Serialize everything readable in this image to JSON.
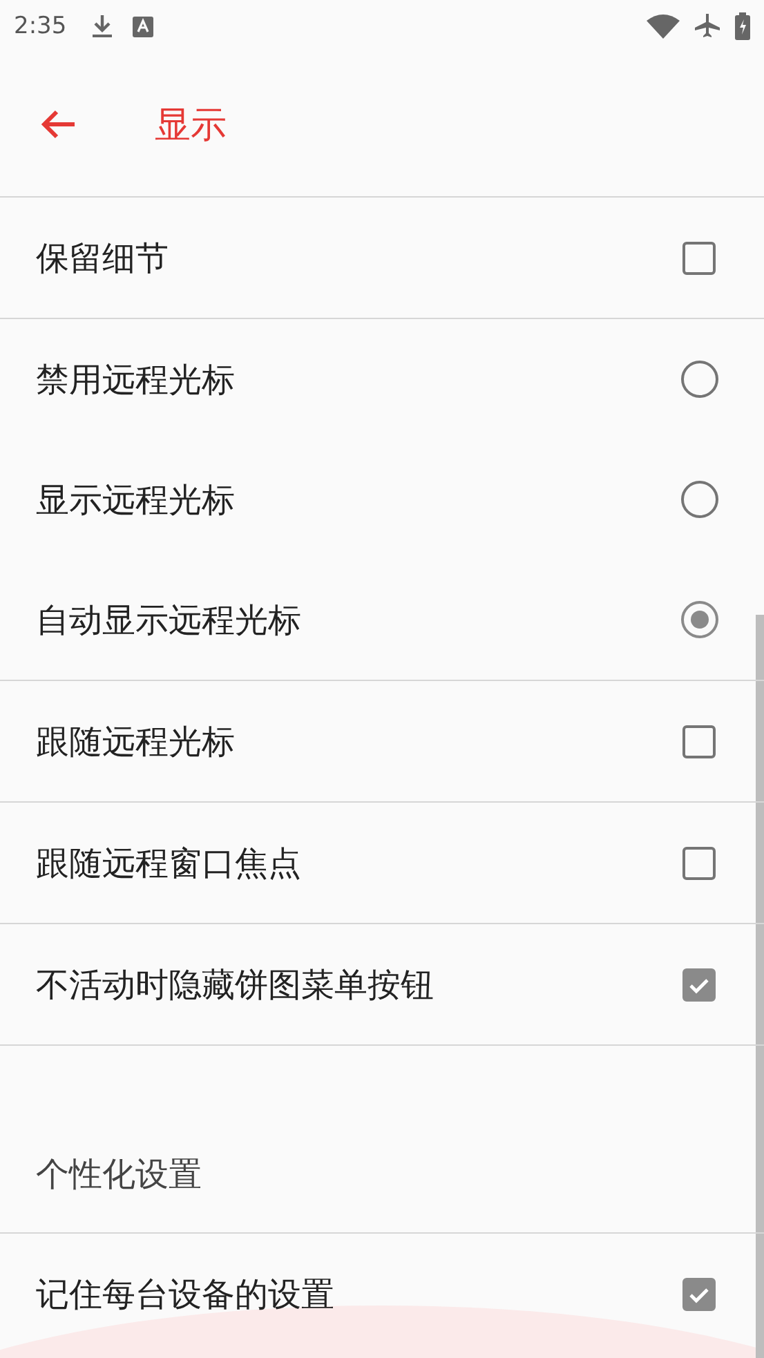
{
  "status_bar": {
    "time": "2:35"
  },
  "app_bar": {
    "title": "显示"
  },
  "groups": [
    {
      "items": [
        {
          "kind": "checkbox",
          "label": "保留细节",
          "checked": false
        }
      ]
    },
    {
      "items": [
        {
          "kind": "radio",
          "label": "禁用远程光标",
          "selected": false
        },
        {
          "kind": "radio",
          "label": "显示远程光标",
          "selected": false
        },
        {
          "kind": "radio",
          "label": "自动显示远程光标",
          "selected": true
        }
      ]
    },
    {
      "items": [
        {
          "kind": "checkbox",
          "label": "跟随远程光标",
          "checked": false
        }
      ]
    },
    {
      "items": [
        {
          "kind": "checkbox",
          "label": "跟随远程窗口焦点",
          "checked": false
        }
      ]
    },
    {
      "items": [
        {
          "kind": "checkbox",
          "label": "不活动时隐藏饼图菜单按钮",
          "checked": true
        }
      ]
    },
    {
      "header": "个性化设置",
      "items": [
        {
          "kind": "checkbox",
          "label": "记住每台设备的设置",
          "checked": true
        }
      ]
    }
  ]
}
